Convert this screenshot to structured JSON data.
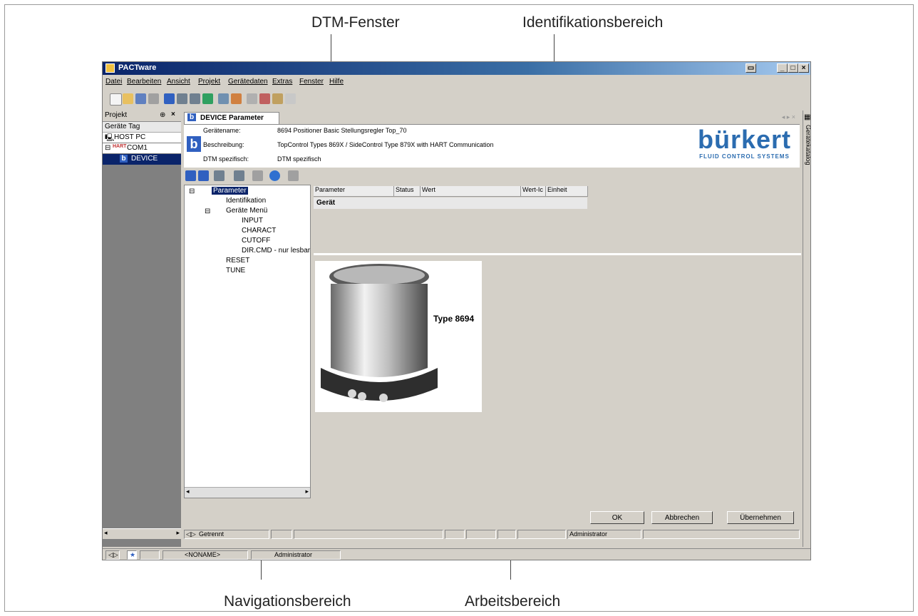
{
  "callouts": {
    "dtm_fenster": "DTM-Fenster",
    "identifikationsbereich": "Identifikationsbereich",
    "navigationsbereich": "Navigationsbereich",
    "arbeitsbereich": "Arbeitsbereich"
  },
  "window": {
    "title": "PACTware"
  },
  "menu": [
    "Datei",
    "Bearbeiten",
    "Ansicht",
    "Projekt",
    "Gerätedaten",
    "Extras",
    "Fenster",
    "Hilfe"
  ],
  "project_pane": {
    "header": "Projekt",
    "column": "Geräte Tag",
    "items": [
      "HOST PC",
      "COM1",
      "DEVICE"
    ]
  },
  "dtm": {
    "tab_label": "DEVICE Parameter",
    "identification": {
      "name_label": "Gerätename:",
      "name_value": "8694 Positioner Basic Stellungsregler Top_70",
      "desc_label": "Beschreibung:",
      "desc_value": "TopControl Types 869X / SideControl Type 879X  with HART Communication",
      "dtm_label": "DTM spezifisch:",
      "dtm_value": "DTM spezifisch"
    },
    "logo": {
      "brand": "bürkert",
      "tagline": "FLUID CONTROL SYSTEMS"
    },
    "nav_tree": [
      "Parameter",
      "Identifikation",
      "Geräte Menü",
      "INPUT",
      "CHARACT",
      "CUTOFF",
      "DIR.CMD - nur lesbar",
      "RESET",
      "TUNE"
    ],
    "grid": {
      "columns": [
        "Parameter",
        "Status",
        "Wert",
        "Wert-Ic",
        "Einheit"
      ],
      "group_row": "Gerät"
    },
    "product_label": "Type 8694",
    "buttons": {
      "ok": "OK",
      "cancel": "Abbrechen",
      "apply": "Übernehmen"
    },
    "status": {
      "connection": "Getrennt",
      "user": "Administrator"
    }
  },
  "right_strip": {
    "label": "Gerätekatalog"
  },
  "bottom_status": {
    "project": "<NONAME>",
    "user": "Administrator"
  },
  "colors": {
    "title_blue": "#0a246a",
    "brand_blue": "#2b6cb0",
    "selection": "#0a246a"
  }
}
